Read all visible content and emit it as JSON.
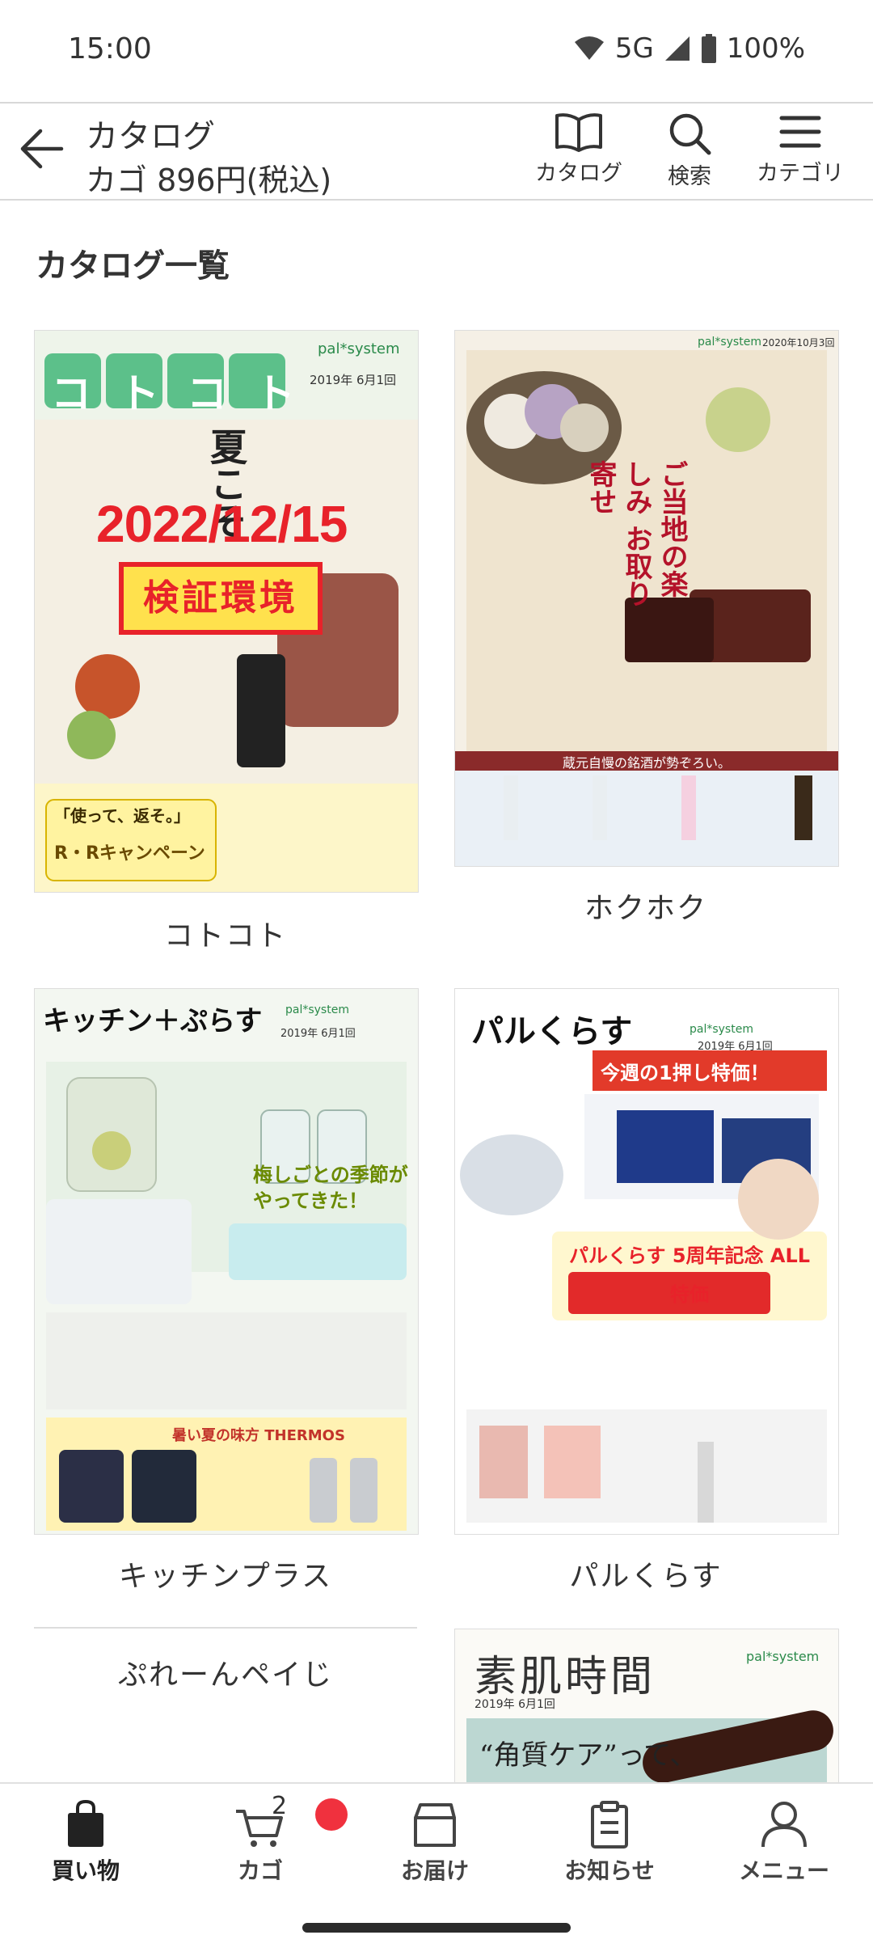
{
  "status_bar": {
    "time": "15:00",
    "network": "5G",
    "battery": "100%"
  },
  "header": {
    "title": "カタログ",
    "cart_total": "カゴ 896円(税込)",
    "actions": [
      {
        "label": "カタログ",
        "icon": "book-icon"
      },
      {
        "label": "検索",
        "icon": "search-icon"
      },
      {
        "label": "カテゴリ",
        "icon": "menu-icon"
      }
    ]
  },
  "section_heading": "カタログ一覧",
  "catalogs": [
    {
      "name": "コトコト",
      "cover": {
        "masthead": "コトコト",
        "headline": "夏こそ",
        "date_label": "2019年 6月1回",
        "stamp_date": "2022/12/15",
        "stamp_label": "検証環境",
        "campaign": "R・Rキャンペーン",
        "campaign_sub": "「使って、返そ。」",
        "brand": "pal*system"
      }
    },
    {
      "name": "ホクホク",
      "cover": {
        "headline": "ご当地の楽しみ お取り寄せ",
        "banner": "蔵元自慢の銘酒が勢ぞろい。",
        "date_label": "2020年10月3回",
        "brand": "pal*system"
      }
    },
    {
      "name": "キッチンプラス",
      "cover": {
        "masthead": "キッチン＋ぷらす",
        "headline": "梅しごとの季節がやってきた！",
        "feature": "暑い夏の味方 THERMOS",
        "date_label": "2019年 6月1回",
        "brand": "pal*system"
      }
    },
    {
      "name": "パルくらす",
      "cover": {
        "masthead": "パルくらす",
        "headline": "今週の1押し特価！",
        "feature": "パルくらす 5周年記念 ALL特価",
        "date_label": "2019年 6月1回",
        "brand": "pal*system"
      }
    },
    {
      "name": "ぷれーんペイじ"
    },
    {
      "name": "素肌時間",
      "cover": {
        "masthead": "素肌時間",
        "tagline": "“角質ケア”って、",
        "date_label": "2019年 6月1回",
        "brand": "pal*system"
      }
    }
  ],
  "bottom_nav": [
    {
      "label": "買い物",
      "icon": "shopping-bag-icon",
      "active": true
    },
    {
      "label": "カゴ",
      "icon": "cart-icon",
      "badge": "2"
    },
    {
      "label": "お届け",
      "icon": "delivery-box-icon"
    },
    {
      "label": "お知らせ",
      "icon": "notice-icon"
    },
    {
      "label": "メニュー",
      "icon": "user-icon"
    }
  ],
  "colors": {
    "accent_red": "#f0313e",
    "stamp_red": "#e8222a",
    "stamp_yellow": "#ffe14d"
  }
}
